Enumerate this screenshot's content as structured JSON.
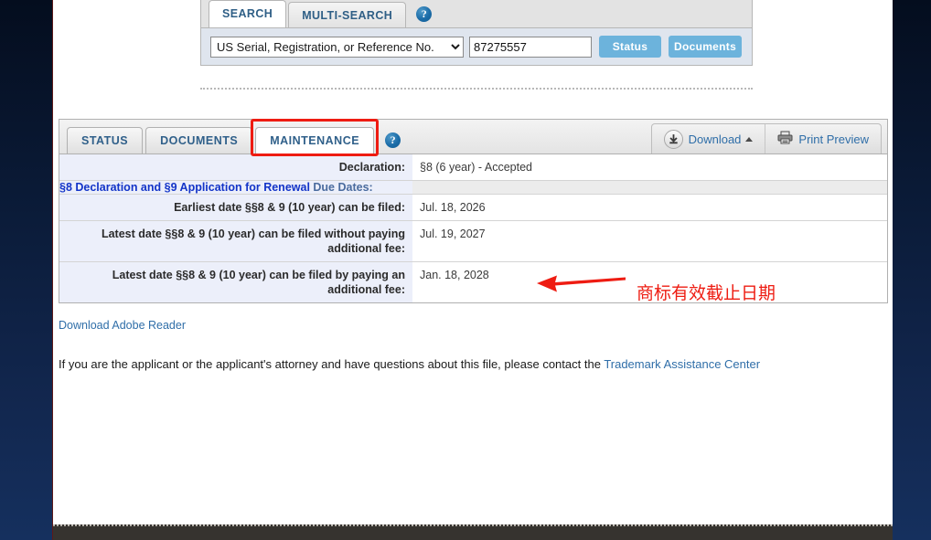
{
  "search_widget": {
    "tabs": [
      {
        "label": "SEARCH",
        "active": true
      },
      {
        "label": "MULTI-SEARCH",
        "active": false
      }
    ],
    "help_icon_glyph": "?",
    "select_value": "US Serial, Registration, or Reference No.",
    "input_value": "87275557",
    "status_button": "Status",
    "documents_button": "Documents"
  },
  "panel": {
    "tabs": [
      {
        "label": "STATUS",
        "active": false,
        "highlighted": false
      },
      {
        "label": "DOCUMENTS",
        "active": false,
        "highlighted": false
      },
      {
        "label": "MAINTENANCE",
        "active": true,
        "highlighted": true
      }
    ],
    "help_icon_glyph": "?",
    "download_label": "Download",
    "print_preview_label": "Print Preview",
    "declaration": {
      "label": "Declaration:",
      "value": "§8 (6 year) - Accepted"
    },
    "section_header": {
      "bold_part": "§8 Declaration and §9 Application for Renewal",
      "dim_part": " Due Dates:"
    },
    "rows": [
      {
        "label": "Earliest date §§8 & 9 (10 year) can be filed:",
        "value": "Jul. 18, 2026"
      },
      {
        "label": "Latest date §§8 & 9 (10 year) can be filed without paying additional fee:",
        "value": "Jul. 19, 2027"
      },
      {
        "label": "Latest date §§8 & 9 (10 year) can be filed by paying an additional fee:",
        "value": "Jan. 18, 2028"
      }
    ]
  },
  "annotation": {
    "text": "商标有效截止日期",
    "color": "#ee1c12"
  },
  "footer": {
    "adobe_link": "Download Adobe Reader",
    "contact_prefix": "If you are the applicant or the applicant's attorney and have questions about this file, please contact the ",
    "contact_link": "Trademark Assistance Center"
  },
  "colors": {
    "rail": "#0a1a36",
    "accent_blue": "#2f6ea8",
    "button_blue": "#6cb3dc",
    "highlight_red": "#ee1c12",
    "label_bg": "#eceffa",
    "header_gray": "#ececec"
  }
}
